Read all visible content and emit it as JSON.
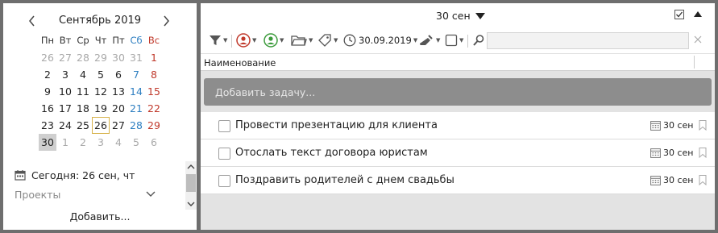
{
  "calendar": {
    "title": "Сентябрь 2019",
    "prev_icon": "chevron-left-icon",
    "next_icon": "chevron-right-icon",
    "weekdays": [
      "Пн",
      "Вт",
      "Ср",
      "Чт",
      "Пт",
      "Сб",
      "Вс"
    ],
    "weeks": [
      [
        "26",
        "27",
        "28",
        "29",
        "30",
        "31",
        "1"
      ],
      [
        "2",
        "3",
        "4",
        "5",
        "6",
        "7",
        "8"
      ],
      [
        "9",
        "10",
        "11",
        "12",
        "13",
        "14",
        "15"
      ],
      [
        "16",
        "17",
        "18",
        "19",
        "20",
        "21",
        "22"
      ],
      [
        "23",
        "24",
        "25",
        "26",
        "27",
        "28",
        "29"
      ],
      [
        "30",
        "1",
        "2",
        "3",
        "4",
        "5",
        "6"
      ]
    ],
    "today_label": "Сегодня: 26 сен, чт",
    "projects_label": "Проекты",
    "add_label": "Добавить...",
    "colors": {
      "saturday": "#2e7fc1",
      "sunday": "#c0392b",
      "other_month": "#a9a9a9",
      "today_border": "#d7b24a",
      "selected_bg": "#cfcfcf"
    }
  },
  "header": {
    "date_label": "30 сен",
    "date_caret_icon": "caret-down-icon",
    "checkbox_icon": "checkbox-icon",
    "collapse_icon": "caret-up-icon"
  },
  "toolbar": {
    "filter_icon": "filter-icon",
    "assignee_icon": "person-red-icon",
    "owner_icon": "person-green-icon",
    "folder_icon": "folder-icon",
    "tag_icon": "tag-icon",
    "date_icon": "clock-icon",
    "date_value": "30.09.2019",
    "clean_icon": "broom-icon",
    "view_icon": "square-icon",
    "search_icon": "search-icon",
    "search_placeholder": "",
    "clear_icon": "close-icon"
  },
  "columns": {
    "name": "Наименование"
  },
  "add_task_placeholder": "Добавить задачу...",
  "tasks": [
    {
      "title": "Провести презентацию для клиента",
      "due": "30 сен"
    },
    {
      "title": "Отослать текст договора юристам",
      "due": "30 сен"
    },
    {
      "title": "Поздравить родителей с днем свадьбы",
      "due": "30 сен"
    }
  ]
}
